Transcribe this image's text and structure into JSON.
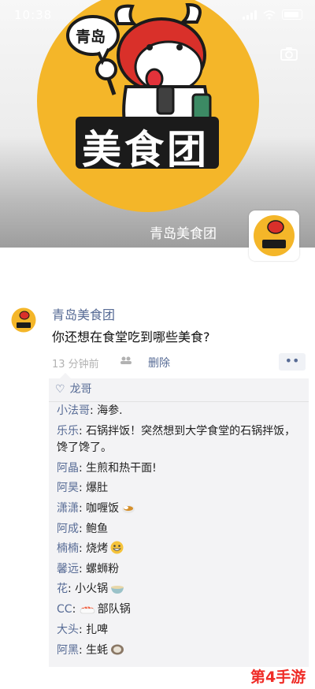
{
  "status_bar": {
    "time": "10:38"
  },
  "cover": {
    "title": "青岛美食团",
    "logo_small_text": "青岛",
    "logo_big_text": "美食团"
  },
  "post": {
    "author": "青岛美食团",
    "text": "你还想在食堂吃到哪些美食?",
    "time": "13 分钟前",
    "delete_label": "删除",
    "more_label": "••"
  },
  "likes": {
    "names": "龙哥"
  },
  "comments": [
    {
      "name": "小法哥",
      "text": "海参."
    },
    {
      "name": "乐乐",
      "text": "石锅拌饭！突然想到大学食堂的石锅拌饭，馋了馋了。"
    },
    {
      "name": "阿晶",
      "text": "生煎和热干面!"
    },
    {
      "name": "阿昊",
      "text": "爆肚"
    },
    {
      "name": "潇潇",
      "text": "咖喱饭",
      "emoji": "curry"
    },
    {
      "name": "阿成",
      "text": "鲍鱼"
    },
    {
      "name": "楠楠",
      "text": "烧烤",
      "emoji": "grin"
    },
    {
      "name": "馨远",
      "text": "螺蛳粉"
    },
    {
      "name": "花",
      "text": "小火锅",
      "emoji": "bowl"
    },
    {
      "name": "CC",
      "text": "部队锅",
      "emoji": "sushi"
    },
    {
      "name": "大头",
      "text": "扎啤"
    },
    {
      "name": "阿黑",
      "text": "生蚝",
      "emoji": "oyster"
    }
  ],
  "watermark": "第4手游",
  "colors": {
    "link": "#576b95",
    "logo_yellow": "#f4b629",
    "logo_red": "#d9302a"
  },
  "icons": [
    "camera-icon",
    "heart-icon",
    "like-dots-icon",
    "signal-icon",
    "wifi-icon",
    "battery-icon"
  ]
}
